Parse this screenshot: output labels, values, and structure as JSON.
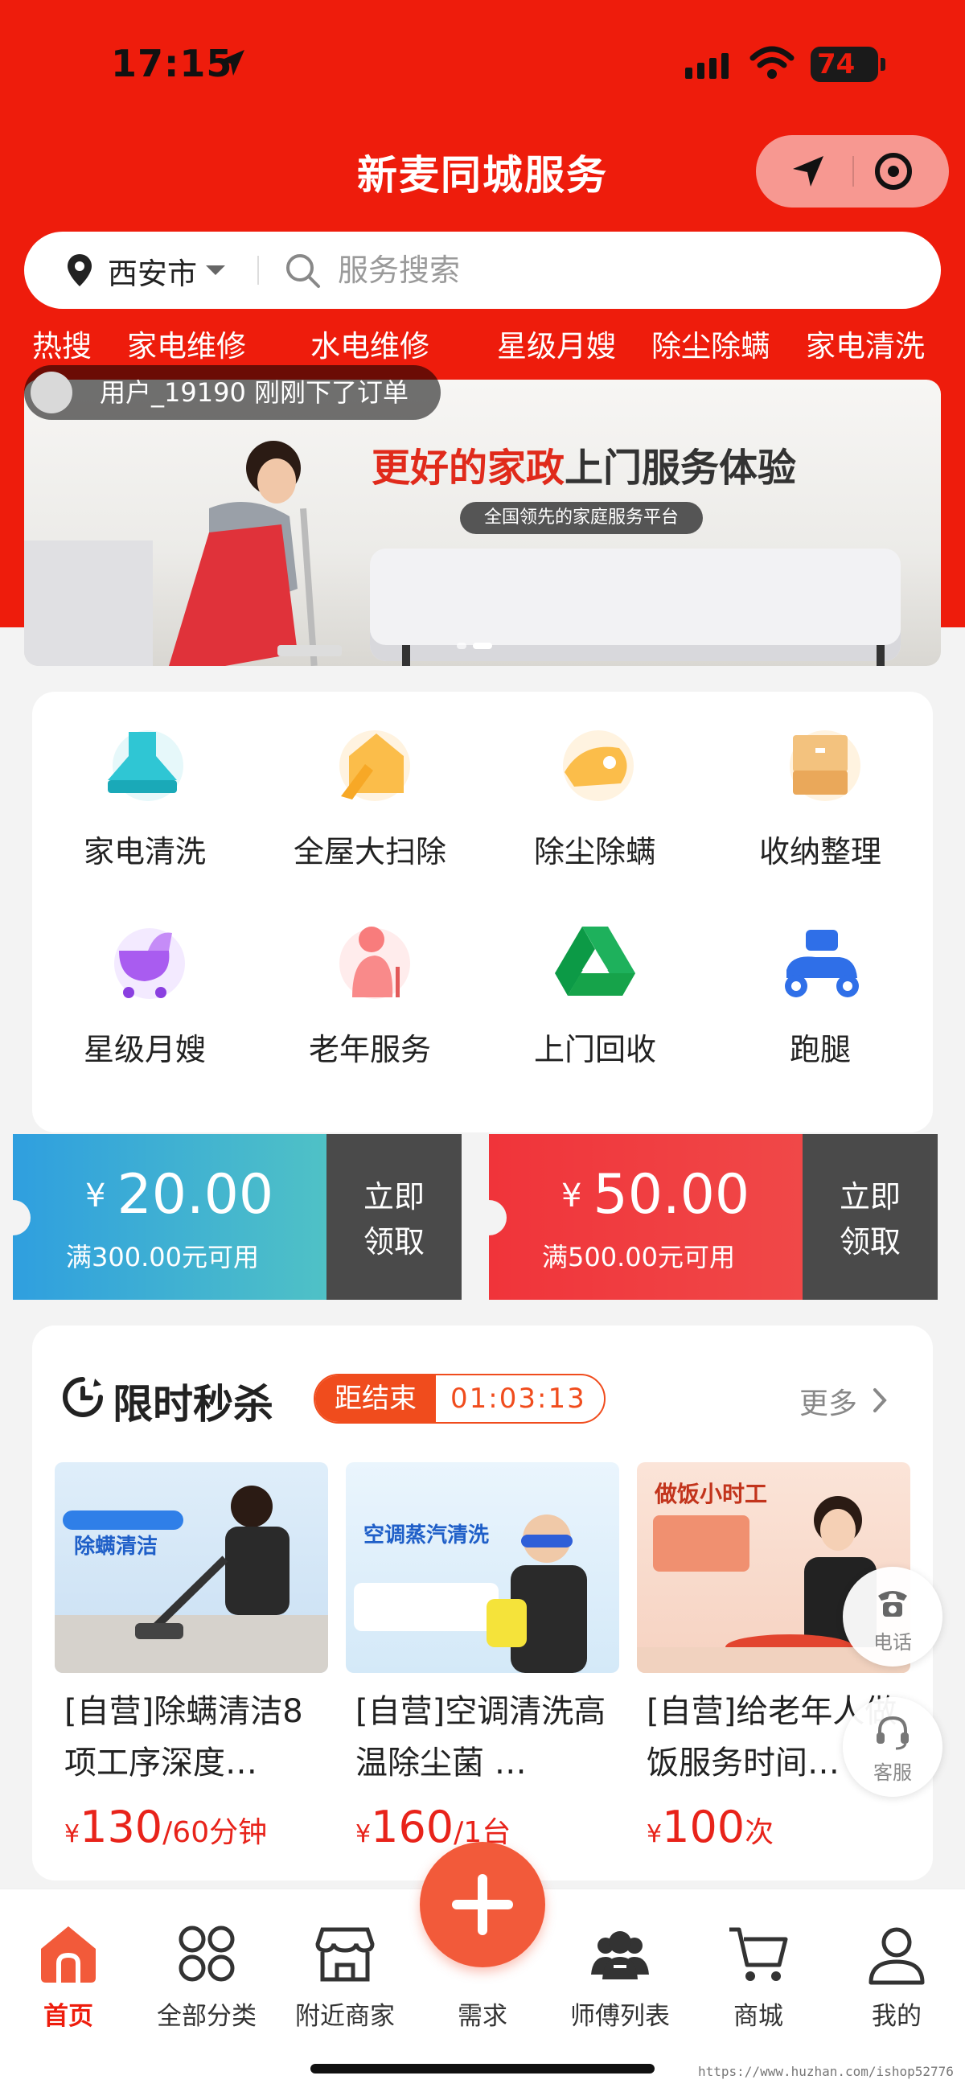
{
  "status_bar": {
    "time": "17:15",
    "battery": "74"
  },
  "header": {
    "title": "新麦同城服务"
  },
  "search": {
    "city": "西安市",
    "placeholder": "服务搜索"
  },
  "hot_tags": [
    "热搜",
    "家电维修",
    "水电维修",
    "星级月嫂",
    "除尘除螨",
    "家电清洗"
  ],
  "order_toast": "用户_19190 刚刚下了订单",
  "banner": {
    "headline_highlight": "更好的家政",
    "headline_rest": "上门服务体验",
    "subtitle": "全国领先的家庭服务平台"
  },
  "categories": [
    {
      "label": "家电清洗",
      "icon": "range-hood-icon"
    },
    {
      "label": "全屋大扫除",
      "icon": "broom-house-icon"
    },
    {
      "label": "除尘除螨",
      "icon": "vacuum-icon"
    },
    {
      "label": "收纳整理",
      "icon": "storage-box-icon"
    },
    {
      "label": "星级月嫂",
      "icon": "baby-stroller-icon"
    },
    {
      "label": "老年服务",
      "icon": "elderly-person-icon"
    },
    {
      "label": "上门回收",
      "icon": "recycle-icon"
    },
    {
      "label": "跑腿",
      "icon": "scooter-icon"
    }
  ],
  "coupons": [
    {
      "currency": "¥",
      "amount": "20.00",
      "condition": "满300.00元可用",
      "action_line1": "立即",
      "action_line2": "领取",
      "color_from": "#2f9fdf",
      "color_to": "#4fc1c6"
    },
    {
      "currency": "¥",
      "amount": "50.00",
      "condition": "满500.00元可用",
      "action_line1": "立即",
      "action_line2": "领取",
      "color_from": "#f0343a",
      "color_to": "#f04848"
    }
  ],
  "flash_sale": {
    "title": "限时秒杀",
    "countdown_label": "距结束",
    "countdown": "01:03:13",
    "more": "更多",
    "products": [
      {
        "name": "[自营]除螨清洁8项工序深度…",
        "currency": "¥",
        "price": "130",
        "unit": "/60分钟",
        "image_caption": "除螨清洁"
      },
      {
        "name": "[自营]空调清洗高温除尘菌 …",
        "currency": "¥",
        "price": "160",
        "unit": "/1台",
        "image_caption": "空调蒸汽清洗"
      },
      {
        "name": "[自营]给老年人做饭服务时间…",
        "currency": "¥",
        "price": "100",
        "unit": "次",
        "image_caption": "做饭小时工"
      }
    ]
  },
  "floating": {
    "phone": "电话",
    "service": "客服"
  },
  "tabbar": {
    "items": [
      {
        "label": "首页",
        "icon": "home-icon"
      },
      {
        "label": "全部分类",
        "icon": "grid-icon"
      },
      {
        "label": "附近商家",
        "icon": "shop-icon"
      },
      {
        "label": "需求",
        "icon": "plus-icon"
      },
      {
        "label": "师傅列表",
        "icon": "workers-icon"
      },
      {
        "label": "商城",
        "icon": "cart-icon"
      },
      {
        "label": "我的",
        "icon": "user-icon"
      }
    ]
  },
  "watermark": "https://www.huzhan.com/ishop52776",
  "colors": {
    "brand_red": "#ee1c0c",
    "price_red": "#e8231a",
    "countdown_orange": "#f04c1d"
  }
}
